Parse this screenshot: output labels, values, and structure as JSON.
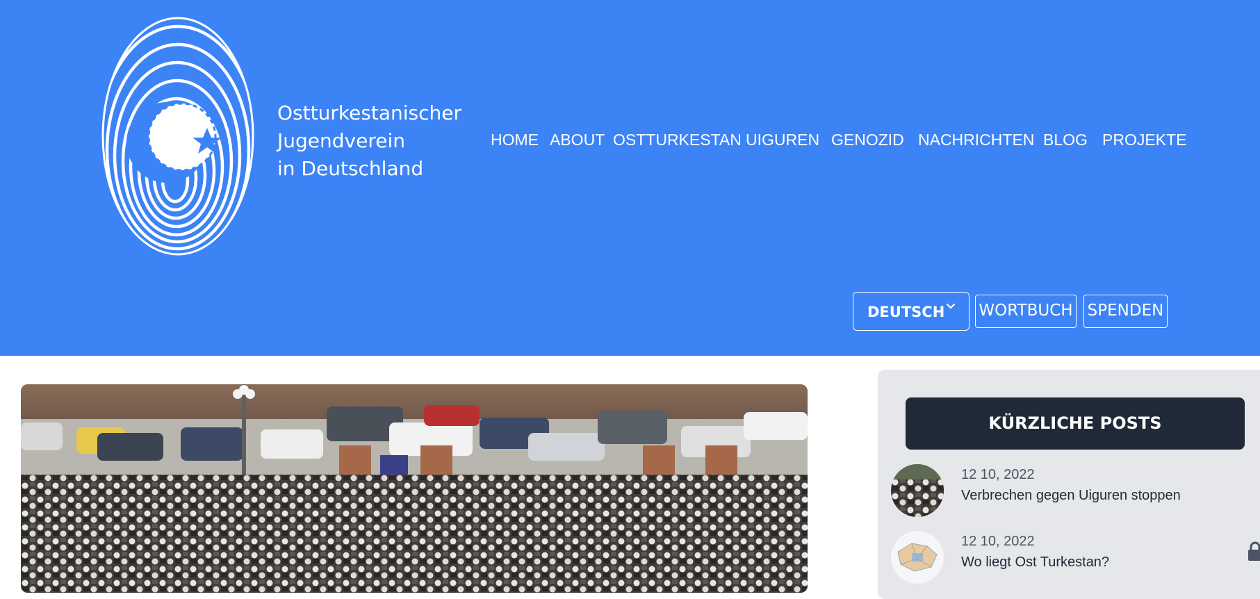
{
  "brand": {
    "line1": "Ostturkestanischer",
    "line2": "Jugendverein",
    "line3": "in Deutschland",
    "logo_icon": "fingerprint-crescent-star-logo"
  },
  "nav": {
    "items": [
      "HOME",
      "ABOUT",
      "OSTTURKESTAN",
      "UIGUREN",
      "GENOZID",
      "NACHRICHTEN",
      "BLOG",
      "PROJEKTE"
    ]
  },
  "actions": {
    "language": "DEUTSCH",
    "language_icon": "chevron-down-icon",
    "dictionary": "WORTBUCH",
    "donate": "SPENDEN"
  },
  "main": {
    "hero_image": "crowd-photo"
  },
  "sidebar": {
    "title": "KÜRZLICHE POSTS",
    "posts": [
      {
        "date": "12 10, 2022",
        "title": "Verbrechen gegen Uiguren stoppen",
        "thumb": "crowd-thumbnail"
      },
      {
        "date": "12 10, 2022",
        "title": "Wo liegt Ost Turkestan?",
        "thumb": "map-thumbnail"
      }
    ]
  },
  "colors": {
    "header_bg": "#3c83f6",
    "sidebar_bg": "#e5e7eb",
    "sidebar_title_bg": "#1f2937",
    "text_white": "#ffffff"
  }
}
